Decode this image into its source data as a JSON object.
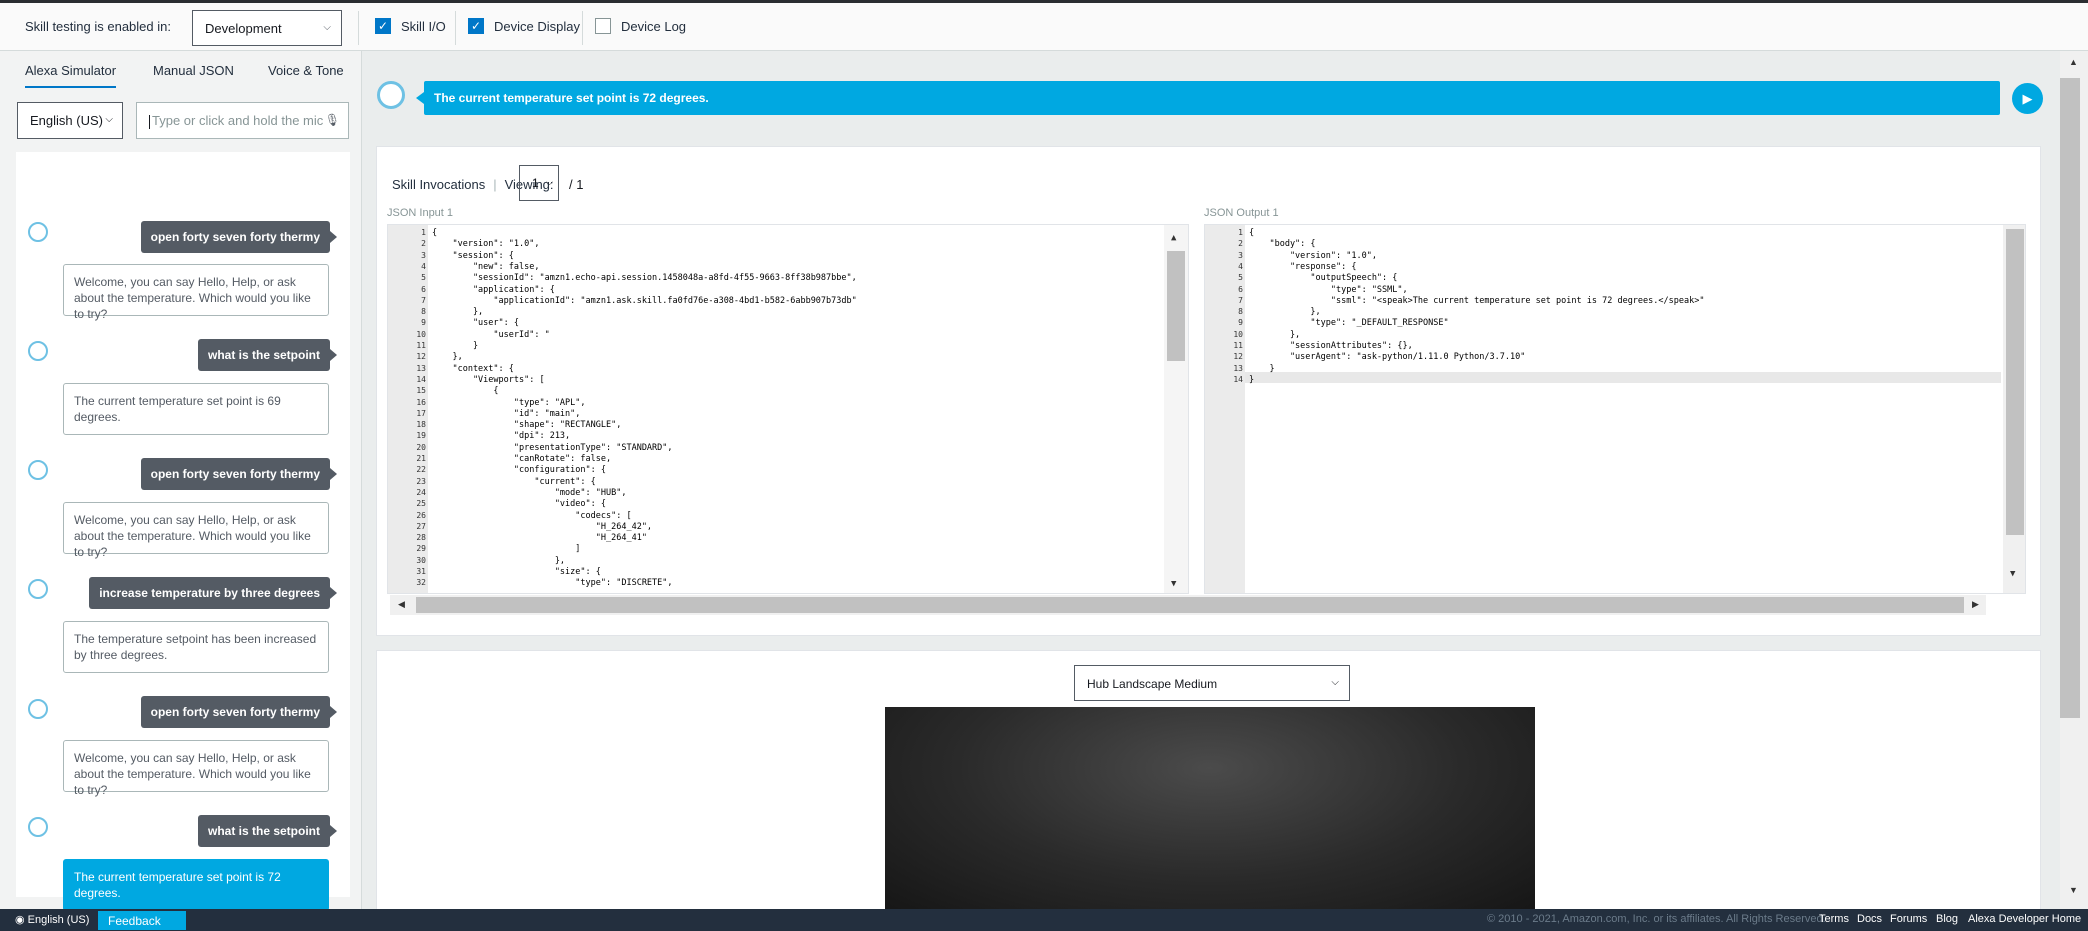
{
  "topbar": {
    "testing_label": "Skill testing is enabled in:",
    "environment": "Development",
    "skill_io": "Skill I/O",
    "device_display": "Device Display",
    "device_log": "Device Log"
  },
  "left": {
    "tabs": [
      "Alexa Simulator",
      "Manual JSON",
      "Voice & Tone"
    ],
    "language": "English (US)",
    "utterance_placeholder": "Type or click and hold the mic",
    "messages": [
      {
        "from": "user",
        "text": "open forty seven forty thermy"
      },
      {
        "from": "alexa",
        "text": "Welcome, you can say Hello, Help, or ask about the temperature. Which would you like to try?"
      },
      {
        "from": "user",
        "text": "what is the setpoint"
      },
      {
        "from": "alexa",
        "text": "The current temperature set point is 69 degrees."
      },
      {
        "from": "user",
        "text": "open forty seven forty thermy"
      },
      {
        "from": "alexa",
        "text": "Welcome, you can say Hello, Help, or ask about the temperature. Which would you like to try?"
      },
      {
        "from": "user",
        "text": "increase temperature by three degrees"
      },
      {
        "from": "alexa",
        "text": "The temperature setpoint has been increased by three degrees."
      },
      {
        "from": "user",
        "text": "open forty seven forty thermy"
      },
      {
        "from": "alexa",
        "text": "Welcome, you can say Hello, Help, or ask about the temperature. Which would you like to try?"
      },
      {
        "from": "user",
        "text": "what is the setpoint"
      },
      {
        "from": "alexa",
        "text": "The current temperature set point is 72 degrees."
      }
    ]
  },
  "speech": "The current temperature set point is 72 degrees.",
  "invocations": {
    "title": "Skill Invocations",
    "viewing_label": "Viewing:",
    "current": "1",
    "total": "/ 1",
    "input_label": "JSON Input 1",
    "output_label": "JSON Output 1",
    "input_lines": [
      "{",
      "    \"version\": \"1.0\",",
      "    \"session\": {",
      "        \"new\": false,",
      "        \"sessionId\": \"amzn1.echo-api.session.1458048a-a8fd-4f55-9663-8ff38b987bbe\",",
      "        \"application\": {",
      "            \"applicationId\": \"amzn1.ask.skill.fa0fd76e-a308-4bd1-b582-6abb907b73db\"",
      "        },",
      "        \"user\": {",
      "            \"userId\": \"",
      "        }",
      "    },",
      "    \"context\": {",
      "        \"Viewports\": [",
      "            {",
      "                \"type\": \"APL\",",
      "                \"id\": \"main\",",
      "                \"shape\": \"RECTANGLE\",",
      "                \"dpi\": 213,",
      "                \"presentationType\": \"STANDARD\",",
      "                \"canRotate\": false,",
      "                \"configuration\": {",
      "                    \"current\": {",
      "                        \"mode\": \"HUB\",",
      "                        \"video\": {",
      "                            \"codecs\": [",
      "                                \"H_264_42\",",
      "                                \"H_264_41\"",
      "                            ]",
      "                        },",
      "                        \"size\": {",
      "                            \"type\": \"DISCRETE\","
    ],
    "output_lines": [
      "{",
      "    \"body\": {",
      "        \"version\": \"1.0\",",
      "        \"response\": {",
      "            \"outputSpeech\": {",
      "                \"type\": \"SSML\",",
      "                \"ssml\": \"<speak>The current temperature set point is 72 degrees.</speak>\"",
      "            },",
      "            \"type\": \"_DEFAULT_RESPONSE\"",
      "        },",
      "        \"sessionAttributes\": {},",
      "        \"userAgent\": \"ask-python/1.11.0 Python/3.7.10\"",
      "    }",
      "}"
    ]
  },
  "display": {
    "viewport": "Hub Landscape Medium"
  },
  "footer": {
    "language": "English (US)",
    "feedback": "Feedback",
    "copyright": "© 2010 - 2021, Amazon.com, Inc. or its affiliates. All Rights Reserved.",
    "links": [
      "Terms",
      "Docs",
      "Forums",
      "Blog",
      "Alexa Developer Home"
    ]
  }
}
